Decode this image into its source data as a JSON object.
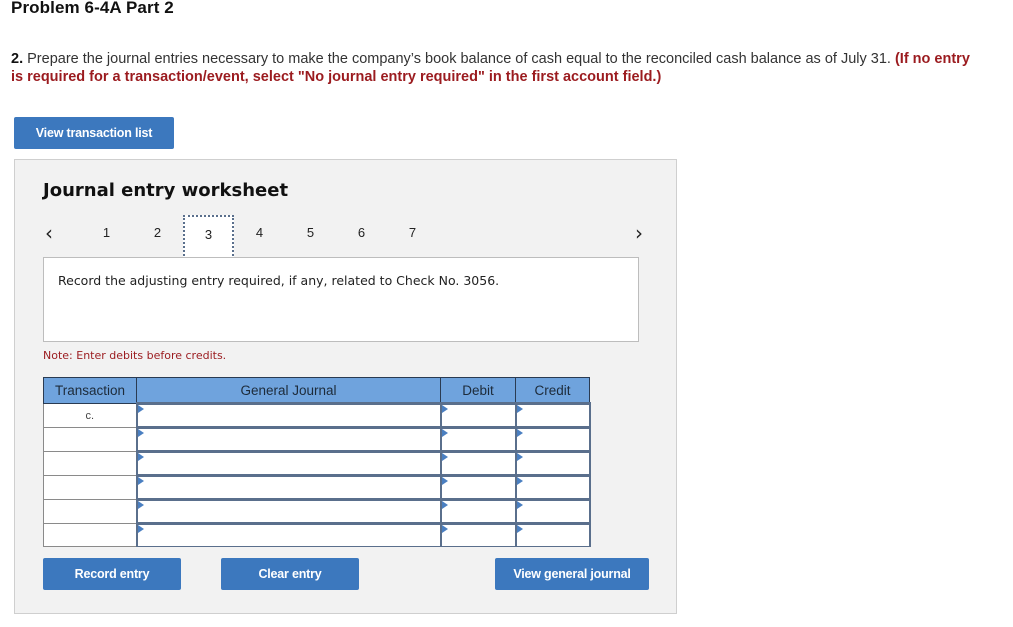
{
  "page": {
    "title": "Problem 6-4A Part 2",
    "instruction_number": "2.",
    "instruction_text": "Prepare the journal entries necessary to make the company’s book balance of cash equal to the reconciled cash balance as of July 31.",
    "instruction_note": "(If no entry is required for a transaction/event, select \"No journal entry required\" in the first account field.)"
  },
  "buttons": {
    "view_transaction_list": "View transaction list",
    "record_entry": "Record entry",
    "clear_entry": "Clear entry",
    "view_general_journal": "View general journal"
  },
  "worksheet": {
    "title": "Journal entry worksheet",
    "prev_icon": "chevron-left-icon",
    "next_icon": "chevron-right-icon",
    "prev_glyph": "‹",
    "next_glyph": "›",
    "tabs": [
      "1",
      "2",
      "3",
      "4",
      "5",
      "6",
      "7"
    ],
    "active_tab": "3",
    "prompt": "Record the adjusting entry required, if any, related to Check No. 3056.",
    "note": "Note: Enter debits before credits."
  },
  "journal": {
    "headers": [
      "Transaction",
      "General Journal",
      "Debit",
      "Credit"
    ],
    "rows": [
      {
        "transaction": "c.",
        "account": "",
        "debit": "",
        "credit": ""
      },
      {
        "transaction": "",
        "account": "",
        "debit": "",
        "credit": ""
      },
      {
        "transaction": "",
        "account": "",
        "debit": "",
        "credit": ""
      },
      {
        "transaction": "",
        "account": "",
        "debit": "",
        "credit": ""
      },
      {
        "transaction": "",
        "account": "",
        "debit": "",
        "credit": ""
      },
      {
        "transaction": "",
        "account": "",
        "debit": "",
        "credit": ""
      }
    ]
  },
  "colors": {
    "button_blue": "#3c78be",
    "header_blue": "#6fa3dd",
    "note_red": "#9b1b1f"
  }
}
